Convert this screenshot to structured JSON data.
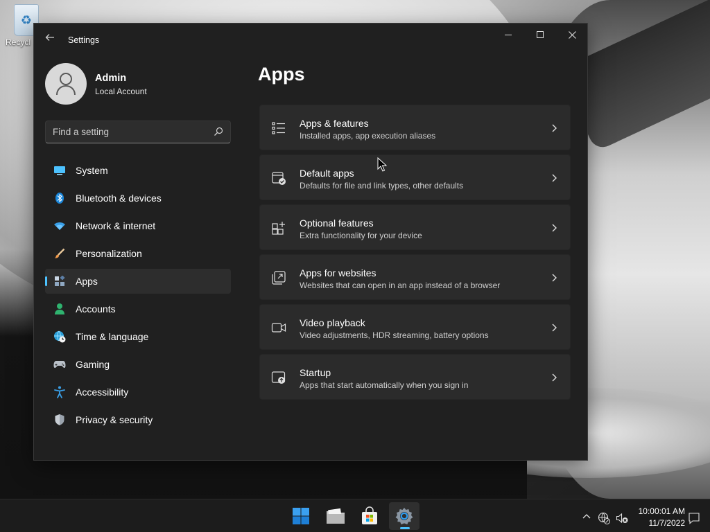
{
  "desktop": {
    "recycle_bin_label": "Recycl",
    "icon_recycle": "recycle-bin-icon"
  },
  "window": {
    "title": "Settings",
    "back_icon": "back-arrow-icon",
    "caption": {
      "minimize": "minimize-icon",
      "maximize": "maximize-icon",
      "close": "close-icon"
    }
  },
  "profile": {
    "name": "Admin",
    "account_type": "Local Account"
  },
  "search": {
    "placeholder": "Find a setting",
    "value": ""
  },
  "nav": {
    "items": [
      {
        "label": "System",
        "icon": "system-icon",
        "active": false
      },
      {
        "label": "Bluetooth & devices",
        "icon": "bluetooth-icon",
        "active": false
      },
      {
        "label": "Network & internet",
        "icon": "wifi-icon",
        "active": false
      },
      {
        "label": "Personalization",
        "icon": "brush-icon",
        "active": false
      },
      {
        "label": "Apps",
        "icon": "apps-icon",
        "active": true
      },
      {
        "label": "Accounts",
        "icon": "person-icon",
        "active": false
      },
      {
        "label": "Time & language",
        "icon": "globe-clock-icon",
        "active": false
      },
      {
        "label": "Gaming",
        "icon": "gamepad-icon",
        "active": false
      },
      {
        "label": "Accessibility",
        "icon": "accessibility-icon",
        "active": false
      },
      {
        "label": "Privacy & security",
        "icon": "shield-icon",
        "active": false
      }
    ]
  },
  "main": {
    "title": "Apps",
    "cards": [
      {
        "title": "Apps & features",
        "subtitle": "Installed apps, app execution aliases",
        "icon": "list-icon"
      },
      {
        "title": "Default apps",
        "subtitle": "Defaults for file and link types, other defaults",
        "icon": "default-apps-icon"
      },
      {
        "title": "Optional features",
        "subtitle": "Extra functionality for your device",
        "icon": "add-grid-icon"
      },
      {
        "title": "Apps for websites",
        "subtitle": "Websites that can open in an app instead of a browser",
        "icon": "open-link-icon"
      },
      {
        "title": "Video playback",
        "subtitle": "Video adjustments, HDR streaming, battery options",
        "icon": "video-camera-icon"
      },
      {
        "title": "Startup",
        "subtitle": "Apps that start automatically when you sign in",
        "icon": "startup-icon"
      }
    ]
  },
  "taskbar": {
    "apps": [
      "start-icon",
      "file-explorer-icon",
      "store-icon",
      "settings-gear-icon"
    ],
    "active_app": "settings-gear-icon",
    "time": "10:00:01 AM",
    "date": "11/7/2022"
  },
  "colors": {
    "accent": "#4cc2ff",
    "window_bg": "#202020",
    "card_bg": "#2b2b2b",
    "taskbar_bg": "#1c1c1c"
  }
}
